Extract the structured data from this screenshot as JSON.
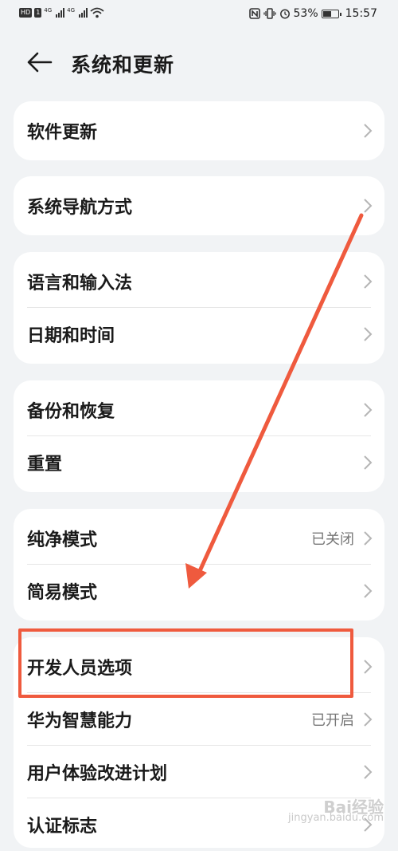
{
  "status_bar": {
    "hd": "HD",
    "sim1": "1",
    "net1": "4G",
    "net2": "4G",
    "battery_text": "53%",
    "time": "15:57"
  },
  "header": {
    "title": "系统和更新"
  },
  "groups": [
    {
      "items": [
        {
          "label": "软件更新"
        }
      ]
    },
    {
      "items": [
        {
          "label": "系统导航方式"
        }
      ]
    },
    {
      "items": [
        {
          "label": "语言和输入法"
        },
        {
          "label": "日期和时间"
        }
      ]
    },
    {
      "items": [
        {
          "label": "备份和恢复"
        },
        {
          "label": "重置"
        }
      ]
    },
    {
      "items": [
        {
          "label": "纯净模式",
          "value": "已关闭"
        },
        {
          "label": "简易模式"
        }
      ]
    },
    {
      "items": [
        {
          "label": "开发人员选项"
        },
        {
          "label": "华为智慧能力",
          "value": "已开启"
        },
        {
          "label": "用户体验改进计划"
        },
        {
          "label": "认证标志"
        }
      ]
    }
  ],
  "annotation": {
    "color": "#ef5a3e"
  },
  "watermark": {
    "brand": "Bai经验",
    "url": "jingyan.baidu.com"
  }
}
